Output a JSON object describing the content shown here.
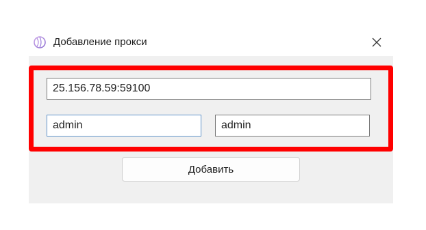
{
  "window": {
    "title": "Добавление прокси",
    "icon": "app-sphere-icon",
    "close_icon": "close-icon"
  },
  "form": {
    "proxy_address": "25.156.78.59:59100",
    "login": "admin",
    "password": "admin",
    "add_button_label": "Добавить"
  },
  "colors": {
    "highlight_border": "#ff0000",
    "dialog_bg": "#f0f0f0",
    "titlebar_bg": "#ffffff",
    "focused_border": "#5f93c9"
  }
}
